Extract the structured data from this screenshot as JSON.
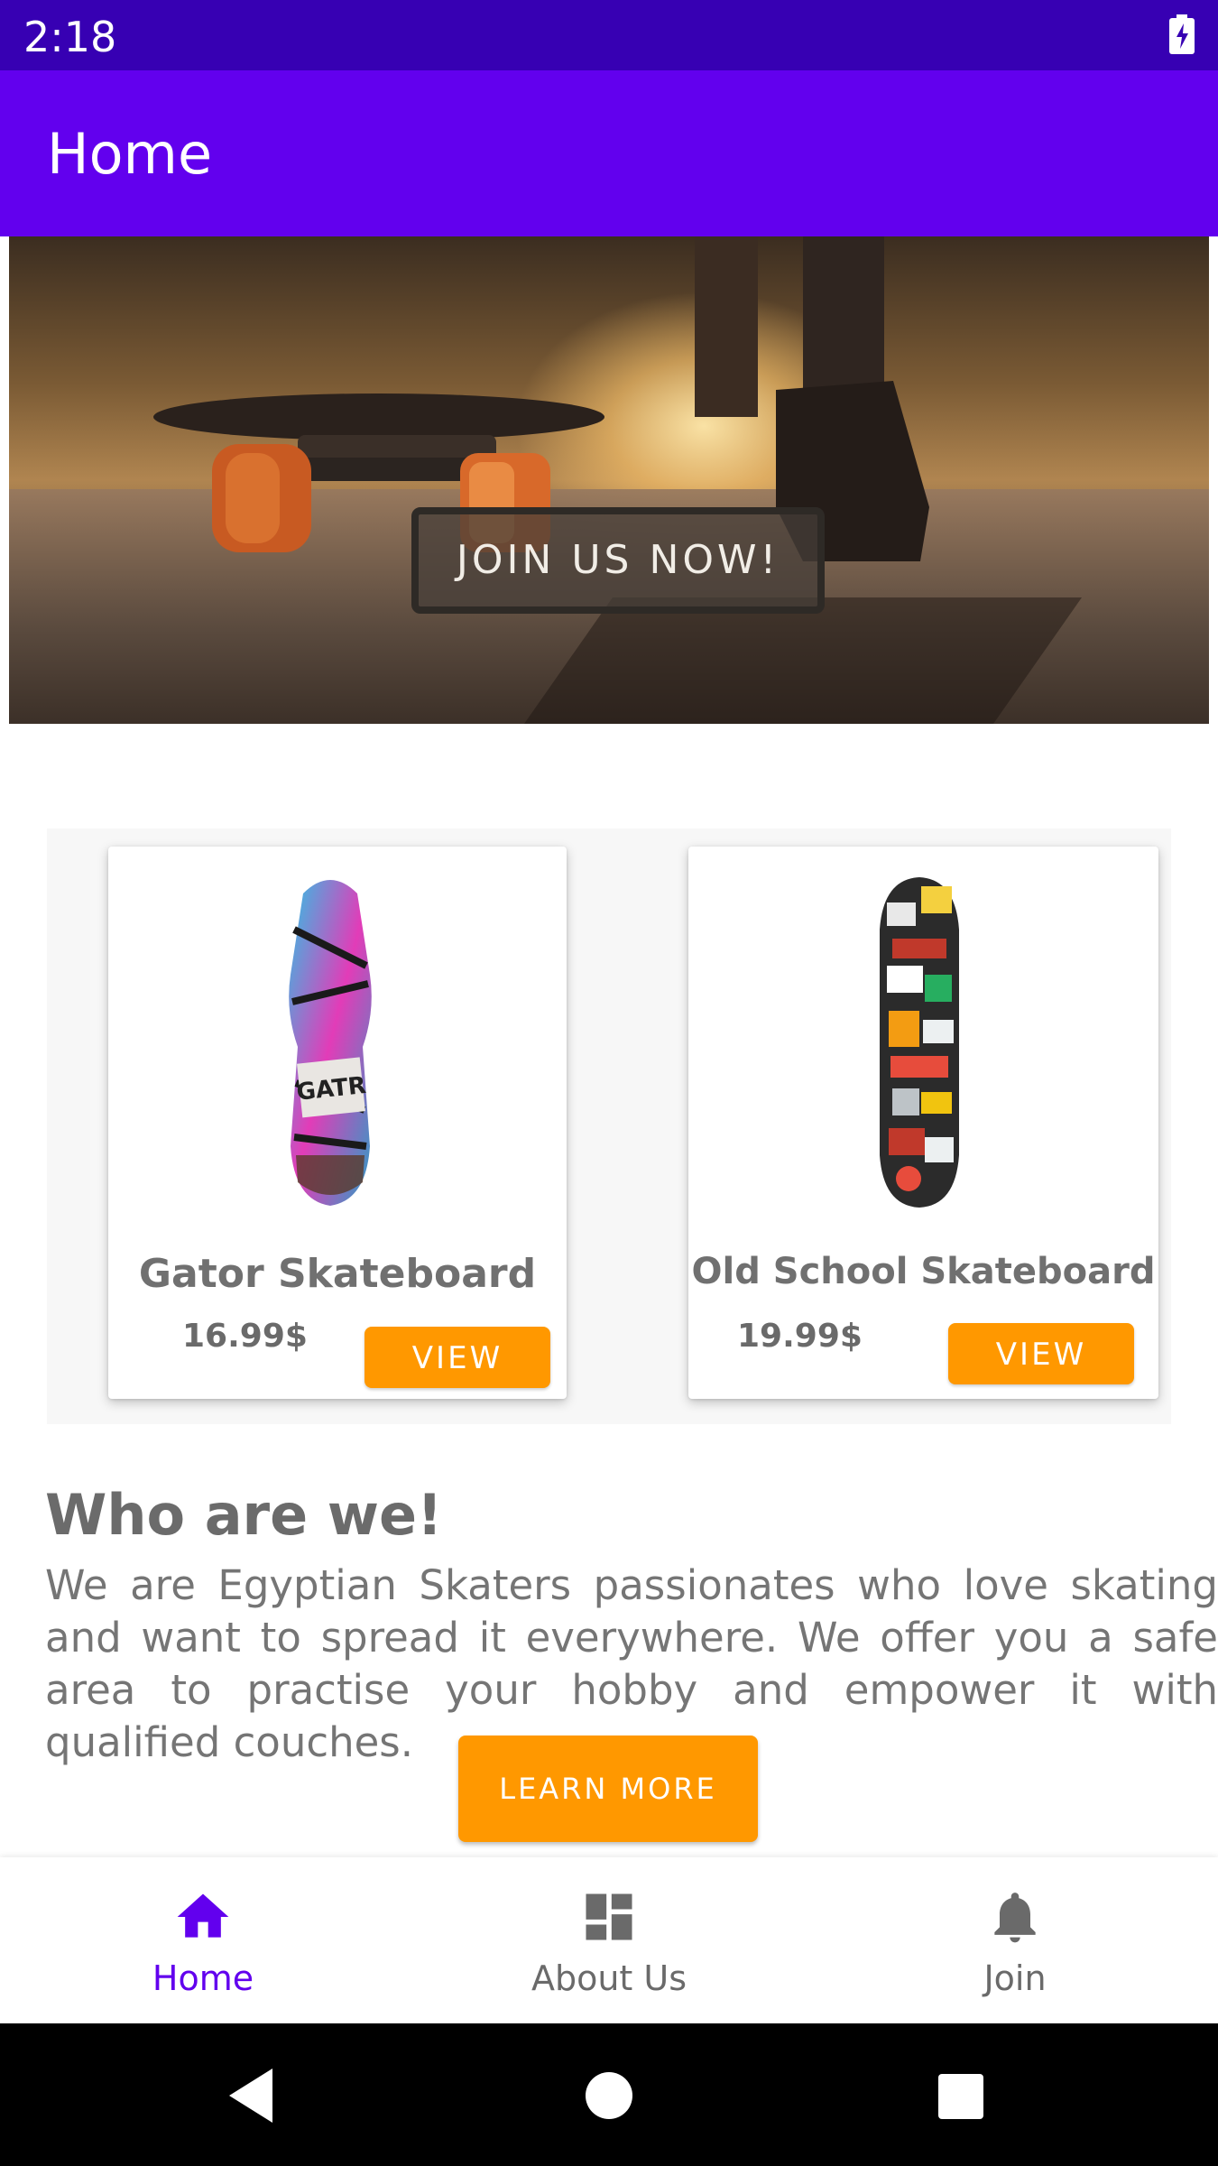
{
  "status_bar": {
    "time": "2:18",
    "icon": "battery-charging-icon"
  },
  "app_bar": {
    "title": "Home"
  },
  "hero": {
    "button_label": "JOIN US NOW!"
  },
  "products": [
    {
      "name": "Gator Skateboard",
      "price": "16.99$",
      "button_label": "VIEW",
      "image": "skateboard-deck-gator-image"
    },
    {
      "name": "Old School Skateboard",
      "price": "19.99$",
      "button_label": "VIEW",
      "image": "skateboard-deck-stickers-image"
    }
  ],
  "about": {
    "title": "Who are we!",
    "text": "We are Egyptian Skaters passionates who love skating and want to spread it everywhere. We offer you a safe area to practise your hobby and empower it with qualified couches.",
    "button_label": "LEARN MORE"
  },
  "bottom_nav": {
    "items": [
      {
        "label": "Home",
        "icon": "home-icon",
        "active": true
      },
      {
        "label": "About Us",
        "icon": "dashboard-icon",
        "active": false
      },
      {
        "label": "Join",
        "icon": "bell-icon",
        "active": false
      }
    ]
  },
  "colors": {
    "status_bar": "#3700B3",
    "primary": "#6200EE",
    "accent": "#FF9800",
    "text_gray": "#707070"
  }
}
